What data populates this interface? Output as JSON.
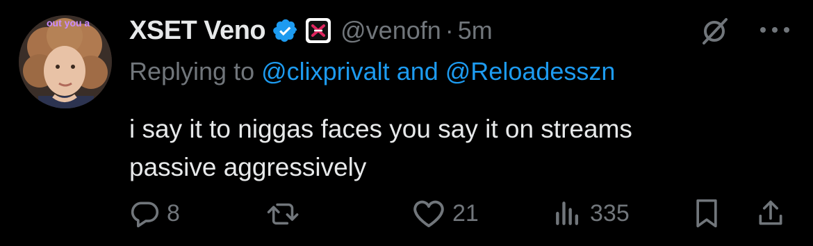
{
  "tweet": {
    "display_name": "XSET Veno",
    "handle": "@venofn",
    "separator": "·",
    "timestamp": "5m",
    "avatar_caption": "out you a",
    "replying_prefix": "Replying to ",
    "reply_mention_1": "@clixprivalt",
    "reply_joiner": " and ",
    "reply_mention_2": "@Reloadesszn",
    "text": "i say it to niggas faces you say it on streams\npassive aggressively"
  },
  "actions": {
    "replies": "8",
    "likes": "21",
    "views": "335"
  },
  "colors": {
    "background": "#000000",
    "primary_text": "#e7e9ea",
    "secondary_text": "#71767b",
    "link": "#1d9bf0",
    "verified": "#1d9bf0",
    "org_badge_accent": "#e0245e"
  },
  "icons": [
    "verified-badge-icon",
    "xset-org-badge-icon",
    "grok-icon",
    "more-icon",
    "reply-icon",
    "retweet-icon",
    "like-icon",
    "views-icon",
    "bookmark-icon",
    "share-icon"
  ]
}
